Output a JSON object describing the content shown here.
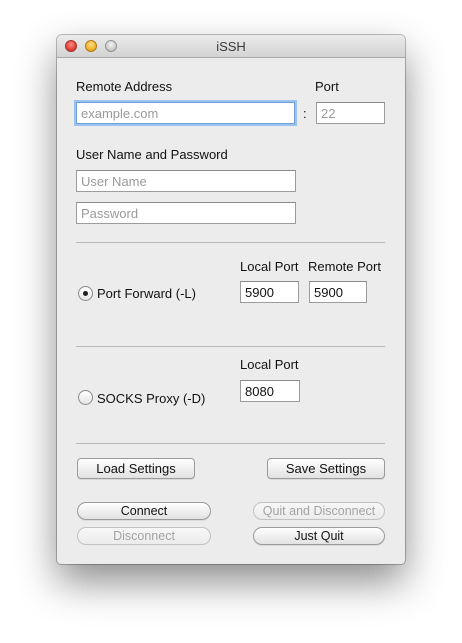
{
  "window": {
    "title": "iSSH"
  },
  "remote": {
    "address_label": "Remote Address",
    "address_placeholder": "example.com",
    "port_label": "Port",
    "port_separator": ":",
    "port_placeholder": "22"
  },
  "credentials": {
    "section_label": "User Name and Password",
    "username_placeholder": "User Name",
    "password_placeholder": "Password"
  },
  "port_forward": {
    "label": "Port Forward (-L)",
    "selected": true,
    "local_port_label": "Local Port",
    "remote_port_label": "Remote Port",
    "local_port_value": "5900",
    "remote_port_value": "5900"
  },
  "socks": {
    "label": "SOCKS Proxy (-D)",
    "selected": false,
    "local_port_label": "Local Port",
    "local_port_value": "8080"
  },
  "buttons": {
    "load_settings": "Load Settings",
    "save_settings": "Save Settings",
    "connect": "Connect",
    "quit_and_disconnect": "Quit and Disconnect",
    "disconnect": "Disconnect",
    "just_quit": "Just Quit"
  }
}
